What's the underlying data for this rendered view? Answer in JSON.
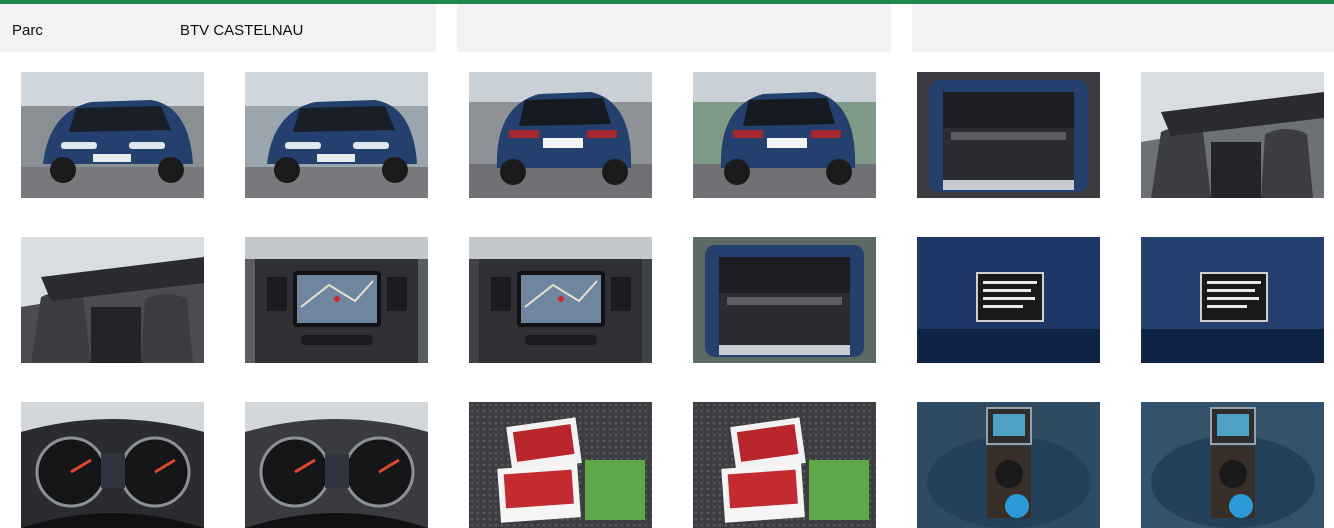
{
  "header": {
    "park_label": "Parc",
    "park_value": "BTV CASTELNAU"
  },
  "colors": {
    "accent": "#1f8a4c",
    "header_bg": "#f2f2f2",
    "car_body": "#23406e"
  },
  "photos": [
    {
      "icon": "car-front-three-quarter-photo",
      "scene": "ext-front",
      "bg": "#8a8f94"
    },
    {
      "icon": "car-front-parking-photo",
      "scene": "ext-front",
      "bg": "#9aa5ad"
    },
    {
      "icon": "car-rear-three-quarter-photo",
      "scene": "ext-rear",
      "bg": "#8e9296"
    },
    {
      "icon": "car-rear-parking-photo",
      "scene": "ext-rear",
      "bg": "#7f9a86"
    },
    {
      "icon": "trunk-cover-photo",
      "scene": "trunk",
      "bg": "#3a3c40"
    },
    {
      "icon": "front-seats-photo",
      "scene": "interior",
      "bg": "#6d7075"
    },
    {
      "icon": "dashboard-passenger-side-photo",
      "scene": "interior",
      "bg": "#4b4c50"
    },
    {
      "icon": "center-console-screen-photo",
      "scene": "screen",
      "bg": "#5a5d61"
    },
    {
      "icon": "navigation-screen-photo",
      "scene": "screen",
      "bg": "#3f4246"
    },
    {
      "icon": "open-trunk-photo",
      "scene": "trunk",
      "bg": "#5d6a63"
    },
    {
      "icon": "vin-plate-photo",
      "scene": "plate",
      "bg": "#1d3766"
    },
    {
      "icon": "door-pillar-plate-photo",
      "scene": "plate",
      "bg": "#24406f"
    },
    {
      "icon": "instrument-cluster-photo",
      "scene": "cluster",
      "bg": "#2b2c2f"
    },
    {
      "icon": "speedometer-photo",
      "scene": "cluster",
      "bg": "#3a3b3e"
    },
    {
      "icon": "brochures-on-seat-photo",
      "scene": "brochure",
      "bg": "#4a4b4e"
    },
    {
      "icon": "brochures-seat-closeup-photo",
      "scene": "brochure",
      "bg": "#404144"
    },
    {
      "icon": "spare-wheel-well-photo",
      "scene": "spare",
      "bg": "#2f4b62"
    },
    {
      "icon": "repair-kit-well-photo",
      "scene": "spare",
      "bg": "#33526b"
    }
  ]
}
